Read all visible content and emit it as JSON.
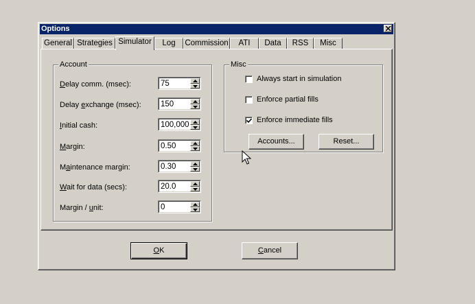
{
  "window": {
    "title": "Options"
  },
  "tabs": [
    {
      "label": "General"
    },
    {
      "label": "Strategies"
    },
    {
      "label": "Simulator"
    },
    {
      "label": "Log"
    },
    {
      "label": "Commission"
    },
    {
      "label": "ATI"
    },
    {
      "label": "Data"
    },
    {
      "label": "RSS"
    },
    {
      "label": "Misc"
    }
  ],
  "account": {
    "legend": "Account",
    "fields": [
      {
        "label_pre": "",
        "label_u": "D",
        "label_post": "elay comm. (msec):",
        "value": "75"
      },
      {
        "label_pre": "Delay ",
        "label_u": "e",
        "label_post": "xchange (msec):",
        "value": "150"
      },
      {
        "label_pre": "",
        "label_u": "I",
        "label_post": "nitial cash:",
        "value": "100,000"
      },
      {
        "label_pre": "",
        "label_u": "M",
        "label_post": "argin:",
        "value": "0.50"
      },
      {
        "label_pre": "M",
        "label_u": "a",
        "label_post": "intenance margin:",
        "value": "0.30"
      },
      {
        "label_pre": "",
        "label_u": "W",
        "label_post": "ait for data (secs):",
        "value": "20.0"
      },
      {
        "label_pre": "Margin / ",
        "label_u": "u",
        "label_post": "nit:",
        "value": "0"
      }
    ]
  },
  "misc": {
    "legend": "Misc",
    "options": [
      {
        "label": "Always start in simulation",
        "checked": false
      },
      {
        "label": "Enforce partial fills",
        "checked": false
      },
      {
        "label": "Enforce immediate fills",
        "checked": true
      }
    ],
    "accounts_button": "Accounts...",
    "reset_button": "Reset..."
  },
  "footer": {
    "ok_u": "O",
    "ok_post": "K",
    "cancel_u": "C",
    "cancel_post": "ancel"
  }
}
